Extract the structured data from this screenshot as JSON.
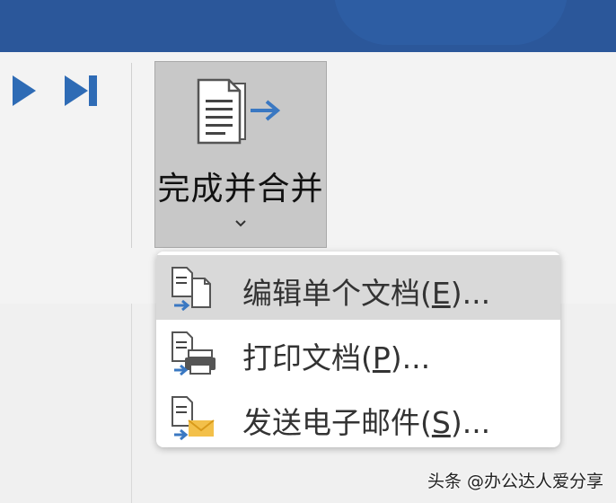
{
  "ribbon": {
    "finish_merge": {
      "label": "完成并合并",
      "icon": "finish-merge-icon"
    },
    "nav": {
      "next_icon": "next-record-icon",
      "last_icon": "last-record-icon"
    }
  },
  "menu": {
    "items": [
      {
        "label_pre": "编辑单个文档(",
        "key": "E",
        "label_post": ")...",
        "icon": "edit-documents-icon",
        "highlighted": true
      },
      {
        "label_pre": "打印文档(",
        "key": "P",
        "label_post": ")...",
        "icon": "print-documents-icon",
        "highlighted": false
      },
      {
        "label_pre": "发送电子邮件(",
        "key": "S",
        "label_post": ")...",
        "icon": "send-email-icon",
        "highlighted": false
      }
    ]
  },
  "watermark": "头条 @办公达人爱分享",
  "colors": {
    "titlebar": "#2b579a",
    "accent_arrow": "#3a78c2",
    "button_pressed": "#c8c8c8",
    "menu_highlight": "#d9d9d9"
  }
}
